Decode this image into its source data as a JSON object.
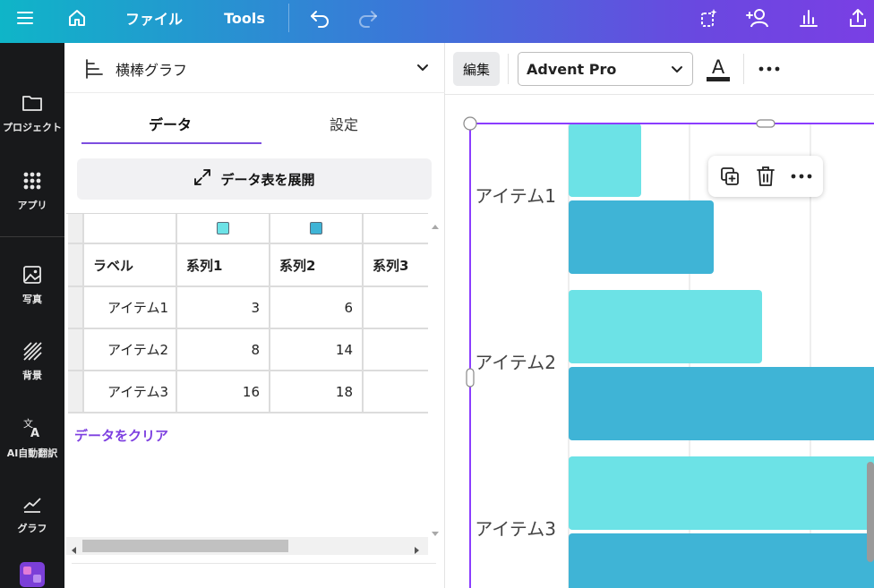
{
  "topbar": {
    "file_label": "ファイル",
    "tools_label": "Tools"
  },
  "rail": {
    "items": [
      {
        "label": "プロジェクト"
      },
      {
        "label": "アプリ"
      },
      {
        "label": "写真"
      },
      {
        "label": "背景"
      },
      {
        "label": "AI自動翻訳"
      },
      {
        "label": "グラフ"
      }
    ]
  },
  "panel": {
    "chart_type": "横棒グラフ",
    "tabs": [
      {
        "label": "データ",
        "active": true
      },
      {
        "label": "設定",
        "active": false
      }
    ],
    "expand_label": "データ表を展開",
    "table": {
      "header_label": "ラベル",
      "series": [
        {
          "name": "系列1",
          "color": "#6ce2e6"
        },
        {
          "name": "系列2",
          "color": "#3fb4d6"
        },
        {
          "name": "系列3",
          "color": ""
        }
      ],
      "rows": [
        {
          "label": "アイテム1",
          "values": [
            "3",
            "6",
            ""
          ]
        },
        {
          "label": "アイテム2",
          "values": [
            "8",
            "14",
            ""
          ]
        },
        {
          "label": "アイテム3",
          "values": [
            "16",
            "18",
            ""
          ]
        }
      ]
    },
    "clear_label": "データをクリア"
  },
  "editor": {
    "edit_label": "編集",
    "font_name": "Advent Pro"
  },
  "chart_data": {
    "type": "bar",
    "orientation": "horizontal",
    "categories": [
      "アイテム1",
      "アイテム2",
      "アイテム3"
    ],
    "series": [
      {
        "name": "系列1",
        "values": [
          3,
          8,
          16
        ],
        "color": "#6ce2e6"
      },
      {
        "name": "系列2",
        "values": [
          6,
          14,
          18
        ],
        "color": "#3fb4d6"
      }
    ],
    "xlim": [
      0,
      12.5
    ],
    "grid": true,
    "title": "",
    "xlabel": "",
    "ylabel": ""
  },
  "colors": {
    "accent": "#7d4ee0",
    "rail_bg": "#18191b"
  }
}
